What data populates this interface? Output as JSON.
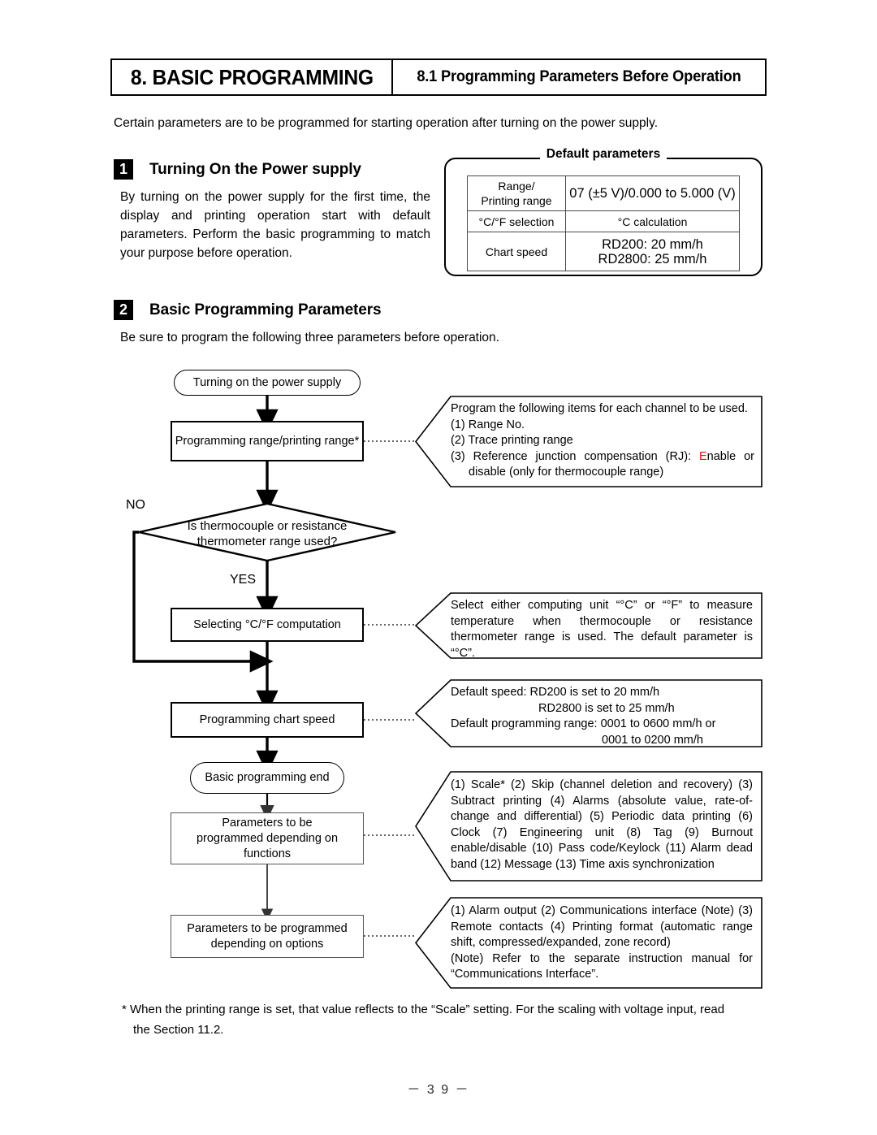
{
  "header": {
    "chapter": "8. BASIC PROGRAMMING",
    "section": "8.1 Programming Parameters Before Operation"
  },
  "intro": "Certain parameters are to be programmed for starting operation after turning on the power supply.",
  "section1": {
    "badge": "1",
    "title": "Turning On the Power supply",
    "body": "By turning on the power supply for the first time, the display and printing operation start with default parameters. Perform the basic programming to match your purpose before operation."
  },
  "section2": {
    "badge": "2",
    "title": "Basic Programming Parameters",
    "body": "Be sure to program the following three parameters before operation."
  },
  "default_parameters": {
    "title": "Default parameters",
    "rows": [
      {
        "label_line1": "Range/",
        "label_line2": "Printing range",
        "value_line1": "07 (±5 V)/0.000 to 5.000 (V)",
        "value_line2": ""
      },
      {
        "label_line1": "°C/°F selection",
        "label_line2": "",
        "value_line1": "°C calculation",
        "value_line2": ""
      },
      {
        "label_line1": "Chart speed",
        "label_line2": "",
        "value_line1": "RD200: 20 mm/h",
        "value_line2": "RD2800: 25 mm/h"
      }
    ]
  },
  "flowchart": {
    "nodes": {
      "start": "Turning on the power supply",
      "range": "Programming range/printing range*",
      "decision_line1": "Is thermocouple or resistance",
      "decision_line2": "thermometer range used?",
      "branch_no": "NO",
      "branch_yes": "YES",
      "cf": "Selecting °C/°F computation",
      "chart_speed": "Programming chart speed",
      "end": "Basic programming end",
      "functions_line1": "Parameters to be",
      "functions_line2": "programmed depending on",
      "functions_line3": "functions",
      "options_line1": "Parameters to be programmed",
      "options_line2": "depending on options"
    },
    "callouts": {
      "range": {
        "line1": "Program the following items for each channel to be used.",
        "line2": "(1) Range No.",
        "line3": "(2) Trace printing range",
        "line4_a": "(3) Reference junction compensation (RJ): ",
        "line4_red": "E",
        "line4_b": "nable or",
        "line5": "disable (only for thermocouple range)"
      },
      "cf": "Select either computing unit “°C” or “°F” to measure temperature when thermocouple or resistance thermometer range is used. The default parameter is “°C”.",
      "chart_speed": {
        "line1": "Default speed:  RD200 is set to 20 mm/h",
        "line2": "RD2800 is set to 25 mm/h",
        "line3": "Default programming range: 0001 to 0600 mm/h or",
        "line4": "0001 to 0200 mm/h"
      },
      "functions": "(1) Scale* (2) Skip (channel deletion and recovery) (3) Subtract printing (4) Alarms (absolute value, rate-of-change and differential) (5) Periodic data printing (6) Clock (7) Engineering unit (8) Tag (9) Burnout enable/disable (10) Pass code/Keylock (11) Alarm dead band (12) Message (13) Time axis synchronization",
      "options": {
        "line1": "(1) Alarm output (2) Communications interface (Note) (3) Remote contacts (4) Printing format (automatic range shift, compressed/expanded, zone record)",
        "line2": "(Note) Refer to the separate instruction manual for “Communications Interface”."
      }
    }
  },
  "footnote": {
    "line1": "* When the printing range is set, that value reflects to the “Scale” setting. For the scaling with voltage input, read",
    "line2": "the Section 11.2."
  },
  "page_number": "－ 3 9 －",
  "colors": {
    "accent_red": "#e8100f",
    "ink": "#000000"
  }
}
